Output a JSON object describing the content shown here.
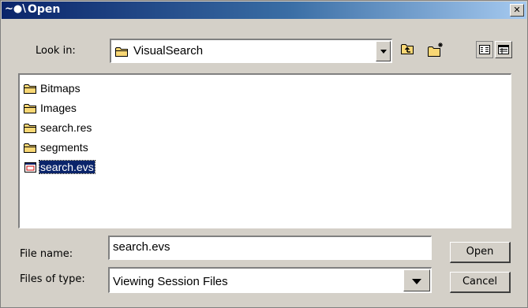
{
  "titlebar": {
    "app_icon_glyph": "~●\\",
    "title": "Open",
    "close_glyph": "✕"
  },
  "lookin": {
    "label": "Look in:",
    "value": "VisualSearch"
  },
  "files": [
    {
      "name": "Bitmaps",
      "type": "folder"
    },
    {
      "name": "Images",
      "type": "folder"
    },
    {
      "name": "search.res",
      "type": "folder"
    },
    {
      "name": "segments",
      "type": "folder"
    },
    {
      "name": "search.evs",
      "type": "file",
      "selected": true
    }
  ],
  "filename": {
    "label": "File name:",
    "value": "search.evs"
  },
  "filetype": {
    "label": "Files of type:",
    "value": "Viewing Session Files"
  },
  "buttons": {
    "open": "Open",
    "cancel": "Cancel"
  },
  "colors": {
    "title_start": "#0a246a",
    "title_end": "#a6caf0",
    "selection": "#0a246a",
    "face": "#d4d0c8",
    "folder": "#f8d775"
  },
  "icons": [
    "up-one-level-icon",
    "create-new-folder-icon",
    "list-view-icon",
    "details-view-icon"
  ]
}
